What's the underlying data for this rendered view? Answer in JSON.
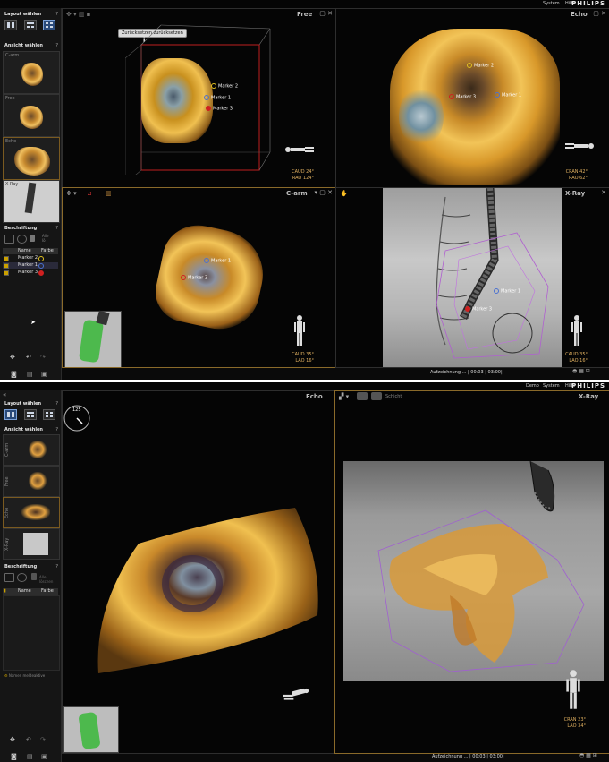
{
  "brand": "PHILIPS",
  "shot1": {
    "menu": [
      "System",
      "Hilfe"
    ],
    "sidebar": {
      "layout_heading": "Layout wählen",
      "view_heading": "Ansicht wählen",
      "thumbs": [
        "C-arm",
        "Free",
        "Echo",
        "X-Ray"
      ],
      "annotation_heading": "Beschriftung",
      "hint": "Alle\nlö",
      "table_head": {
        "name": "Name",
        "color": "Farbe"
      },
      "markers": [
        {
          "name": "Marker 2",
          "color": "#e0c020"
        },
        {
          "name": "Marker 1",
          "color": "#4a70d0"
        },
        {
          "name": "Marker 3",
          "color": "#d02020"
        }
      ]
    },
    "viewports": {
      "free": {
        "title": "Free",
        "button": "Zurücksetzen zurücksetzen",
        "info": "i",
        "orientation": [
          "CAUD 24°",
          "RAO 124°"
        ],
        "markers": [
          "Marker 2",
          "Marker 1",
          "Marker 3"
        ]
      },
      "echo": {
        "title": "Echo",
        "orientation": [
          "CRAN 42°",
          "RAO 62°"
        ],
        "markers": [
          "Marker 2",
          "Marker 3",
          "Marker 1"
        ]
      },
      "carm": {
        "title": "C-arm",
        "orientation": [
          "CAUD 35°",
          "LAO 16°"
        ],
        "markers": [
          "Marker 1",
          "Marker 3"
        ]
      },
      "xray": {
        "title": "X-Ray",
        "orientation": [
          "CAUD 35°",
          "LAO 16°"
        ],
        "markers": [
          "Marker 1",
          "Marker 3"
        ]
      }
    },
    "status": "Aufzeichnung ... | 00:03 | 03:00|"
  },
  "shot2": {
    "menu": [
      "Demo",
      "System",
      "Hilfe"
    ],
    "sidebar": {
      "layout_heading": "Layout wählen",
      "view_heading": "Ansicht wählen",
      "thumbs": [
        "C-arm",
        "Free",
        "Echo",
        "X-Ray"
      ],
      "annotation_heading": "Beschriftung",
      "hint": "Alle löschen",
      "table_head": {
        "name": "Name",
        "color": "Farbe"
      },
      "footer_note": "Namen meldeaktive"
    },
    "viewports": {
      "echo": {
        "title": "Echo",
        "dial": "125"
      },
      "xray": {
        "title": "X-Ray",
        "tab": "Schicht",
        "orientation": [
          "CRAN 23°",
          "LAO 34°"
        ]
      }
    },
    "status": "Aufzeichnung ... | 00:03 | 03:00|"
  }
}
